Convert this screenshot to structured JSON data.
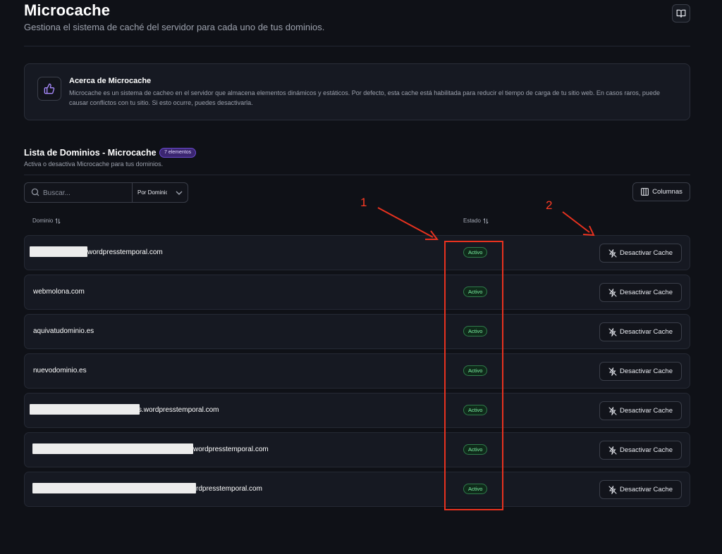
{
  "header": {
    "title": "Microcache",
    "subtitle": "Gestiona el sistema de caché del servidor para cada uno de tus dominios."
  },
  "info": {
    "title": "Acerca de Microcache",
    "text": "Microcache es un sistema de cacheo en el servidor que almacena elementos dinámicos y estáticos. Por defecto, esta cache está habilitada para reducir el tiempo de carga de tu sitio web. En casos raros, puede causar conflictos con tu sitio. Si esto ocurre, puedes desactivarla."
  },
  "list": {
    "title": "Lista de Dominios - Microcache",
    "count_badge": "7 elementos",
    "subtitle": "Activa o desactiva Microcache para tus dominios."
  },
  "toolbar": {
    "search_placeholder": "Buscar...",
    "filter_value": "Por Dominio",
    "columns_label": "Columnas"
  },
  "table": {
    "headers": {
      "domain": "Dominio",
      "status": "Estado"
    },
    "rows": [
      {
        "domain": "wordpresstemporal.com",
        "status": "Activo",
        "action": "Desactivar Cache"
      },
      {
        "domain": "webmolona.com",
        "status": "Activo",
        "action": "Desactivar Cache"
      },
      {
        "domain": "aquivatudominio.es",
        "status": "Activo",
        "action": "Desactivar Cache"
      },
      {
        "domain": "nuevodominio.es",
        "status": "Activo",
        "action": "Desactivar Cache"
      },
      {
        "domain": "s.wordpresstemporal.com",
        "status": "Activo",
        "action": "Desactivar Cache"
      },
      {
        "domain": "wordpresstemporal.com",
        "status": "Activo",
        "action": "Desactivar Cache"
      },
      {
        "domain": "rdpresstemporal.com",
        "status": "Activo",
        "action": "Desactivar Cache"
      }
    ]
  },
  "annotations": {
    "label_1": "1",
    "label_2": "2"
  },
  "colors": {
    "background": "#0f1117",
    "card": "#161922",
    "accent_purple": "#6b4ad1",
    "status_green": "#7cf0a4",
    "annotation_red": "#e8321f"
  },
  "icons": {
    "docs": "book-open-icon",
    "info": "thumbs-up-icon",
    "search": "search-icon",
    "filter": "chevron-down-icon",
    "columns": "columns-icon",
    "sort": "sort-arrows-icon",
    "deactivate": "zap-off-icon"
  }
}
